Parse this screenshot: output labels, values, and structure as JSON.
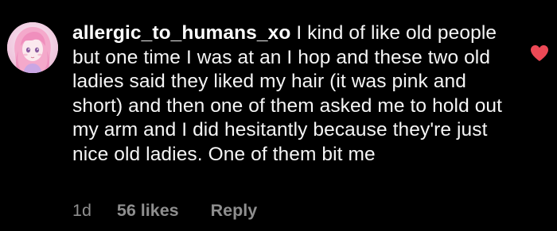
{
  "comment": {
    "username": "allergic_to_humans_xo",
    "text": "I kind of like old people but one time I was at an I hop and these two old ladies said they liked my hair (it was pink and short) and then one of them asked me to hold out my arm and I did hesitantly because they're just nice old ladies. One of them bit me",
    "age": "1d",
    "likes": "56 likes",
    "reply_label": "Reply",
    "liked": true
  },
  "icons": {
    "avatar": "profile-avatar-pink-haired-illustration",
    "like": "heart-icon-filled"
  },
  "colors": {
    "background": "#000000",
    "text": "#f5f5f5",
    "meta": "#8e8e8e",
    "heart": "#ed4956"
  }
}
